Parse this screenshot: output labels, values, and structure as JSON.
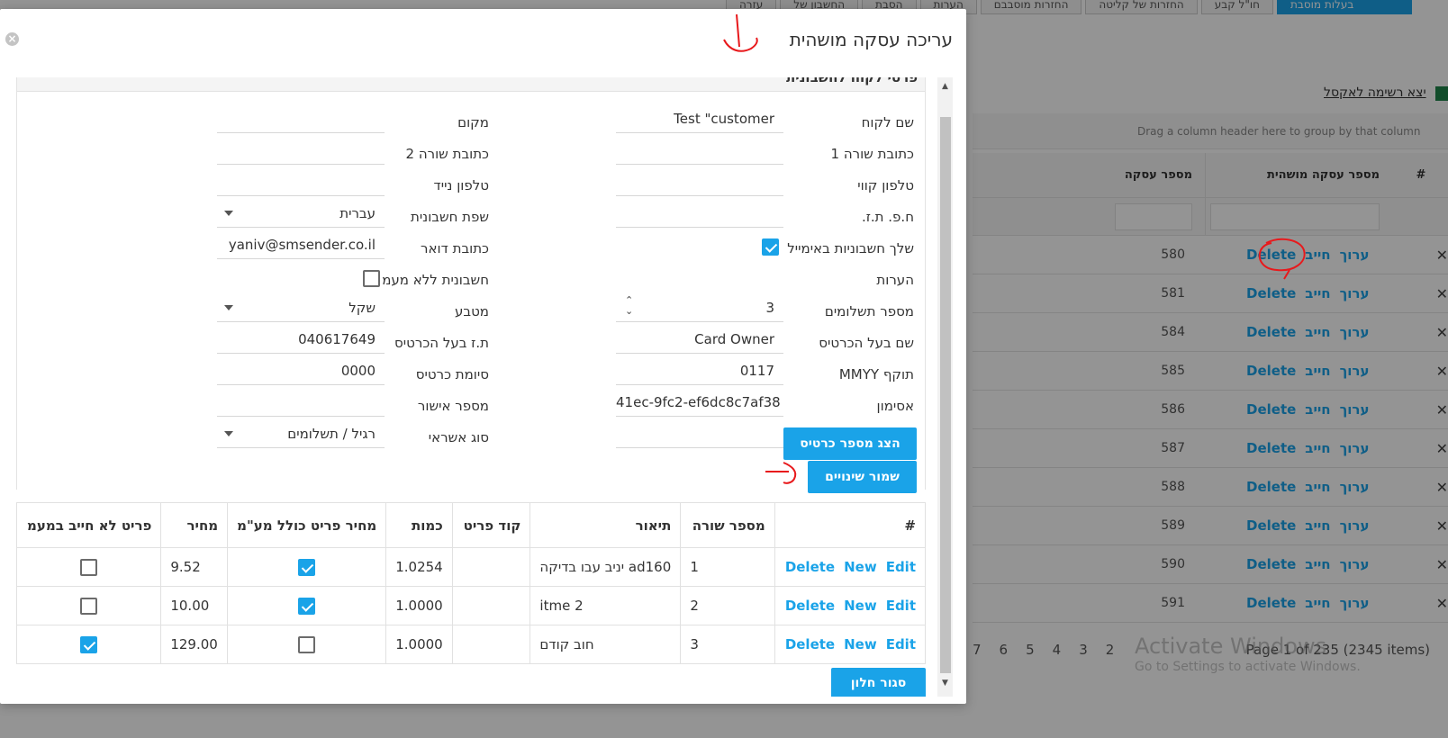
{
  "background": {
    "toolbar_buttons": [
      "בעלות מוסבת",
      "חו\"ל קבע",
      "החזרות של קליטה",
      "החזרות מוסבבם",
      "הערות",
      "הסבת",
      "החשבון של",
      "עזרה"
    ],
    "export_label": "יצא רשימה לאקסל",
    "group_hint": "Drag a column header here to group by that column",
    "columns": {
      "hash": "#",
      "deal_num": "מספר עסקה מושהית",
      "deal": "מספר עסקה"
    },
    "rows": [
      {
        "num": "580",
        "delete": "Delete",
        "charge": "חייב",
        "edit": "ערוך"
      },
      {
        "num": "581",
        "delete": "Delete",
        "charge": "חייב",
        "edit": "ערוך"
      },
      {
        "num": "584",
        "delete": "Delete",
        "charge": "חייב",
        "edit": "ערוך"
      },
      {
        "num": "585",
        "delete": "Delete",
        "charge": "חייב",
        "edit": "ערוך"
      },
      {
        "num": "586",
        "delete": "Delete",
        "charge": "חייב",
        "edit": "ערוך"
      },
      {
        "num": "587",
        "delete": "Delete",
        "charge": "חייב",
        "edit": "ערוך"
      },
      {
        "num": "588",
        "delete": "Delete",
        "charge": "חייב",
        "edit": "ערוך"
      },
      {
        "num": "589",
        "delete": "Delete",
        "charge": "חייב",
        "edit": "ערוך"
      },
      {
        "num": "590",
        "delete": "Delete",
        "charge": "חייב",
        "edit": "ערוך"
      },
      {
        "num": "591",
        "delete": "Delete",
        "charge": "חייב",
        "edit": "ערוך"
      }
    ],
    "pager_pages": [
      "7",
      "6",
      "5",
      "4",
      "3",
      "2"
    ],
    "pager_info": "Page 1 of 235 (2345 items)",
    "watermark_title": "Activate Windows",
    "watermark_sub": "Go to Settings to activate Windows."
  },
  "dialog": {
    "title": "עריכה עסקה מושהית",
    "close_icon": "×",
    "section_title": "פרטי לקוח לחשבונית",
    "fields": {
      "customer_name": {
        "label": "שם לקוח",
        "value": "Test \"customer"
      },
      "place": {
        "label": "מקום",
        "value": ""
      },
      "address1": {
        "label": "כתובת שורה 1",
        "value": ""
      },
      "address2": {
        "label": "כתובת שורה 2",
        "value": ""
      },
      "landline": {
        "label": "טלפון קווי",
        "value": ""
      },
      "mobile": {
        "label": "טלפון נייד",
        "value": ""
      },
      "company_id": {
        "label": "ח.פ. ת.ז.",
        "value": ""
      },
      "invoice_language": {
        "label": "שפת חשבונית",
        "value": "עברית"
      },
      "send_email": {
        "label": "שלך חשבוניות באימייל",
        "checked": true
      },
      "email": {
        "label": "כתובת דואר",
        "value": "yaniv@smsender.co.il"
      },
      "notes": {
        "label": "הערות",
        "value": ""
      },
      "no_vat": {
        "label": "חשבונית ללא מעמ",
        "checked": false
      },
      "payments": {
        "label": "מספר תשלומים",
        "value": "3"
      },
      "currency": {
        "label": "מטבע",
        "value": "שקל"
      },
      "card_owner": {
        "label": "שם בעל הכרטיס",
        "value": "Card Owner"
      },
      "owner_id": {
        "label": "ת.ז בעל הכרטיס",
        "value": "040617649"
      },
      "expiry": {
        "label": "תוקף MMYY",
        "value": "0117"
      },
      "card_suffix": {
        "label": "סיומת כרטיס",
        "value": "0000"
      },
      "token": {
        "label": "אסימון",
        "value": "41ec-9fc2-ef6dc8c7af38"
      },
      "approval": {
        "label": "מספר אישור",
        "value": ""
      },
      "credit_type": {
        "label": "סוג אשראי",
        "value": "רגיל / תשלומים"
      }
    },
    "show_card_button": "הצג מספר כרטיס",
    "save_button": "שמור שינויים",
    "close_button": "סגור חלון",
    "items_table": {
      "headers": [
        "#",
        "מספר שורה",
        "תיאור",
        "קוד פריט",
        "כמות",
        "מחיר פריט כולל מע\"מ",
        "מחיר",
        "פריט לא חייב במעמ"
      ],
      "rows": [
        {
          "edit": "Edit",
          "new": "New",
          "delete": "Delete",
          "line": "1",
          "desc": "ad160 יניב עבו בדיקה",
          "code": "",
          "qty": "1.0254",
          "incl_vat": true,
          "price": "9.52",
          "no_vat": false
        },
        {
          "edit": "Edit",
          "new": "New",
          "delete": "Delete",
          "line": "2",
          "desc": "itme 2",
          "code": "",
          "qty": "1.0000",
          "incl_vat": true,
          "price": "10.00",
          "no_vat": false
        },
        {
          "edit": "Edit",
          "new": "New",
          "delete": "Delete",
          "line": "3",
          "desc": "חוב קודם",
          "code": "",
          "qty": "1.0000",
          "incl_vat": false,
          "price": "129.00",
          "no_vat": true
        }
      ]
    }
  },
  "colors": {
    "accent": "#1aa3e8",
    "annotation": "#e8191c"
  }
}
